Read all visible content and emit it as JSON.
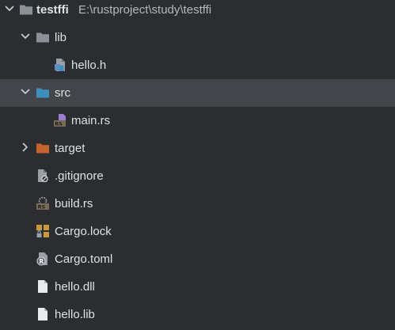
{
  "project_tree": {
    "root": {
      "name": "testffi",
      "path": "E:\\rustproject\\study\\testffi",
      "icon": "folder-icon",
      "expanded": true
    },
    "items": [
      {
        "label": "lib",
        "icon": "folder-icon",
        "type": "folder",
        "expanded": true
      },
      {
        "label": "hello.h",
        "icon": "c-header-file-icon",
        "type": "file"
      },
      {
        "label": "src",
        "icon": "source-folder-icon",
        "type": "folder",
        "expanded": true,
        "selected": true
      },
      {
        "label": "main.rs",
        "icon": "rust-main-file-icon",
        "type": "file"
      },
      {
        "label": "target",
        "icon": "excluded-folder-icon",
        "type": "folder",
        "expanded": false
      },
      {
        "label": ".gitignore",
        "icon": "ignore-file-icon",
        "type": "file"
      },
      {
        "label": "build.rs",
        "icon": "rust-file-icon",
        "type": "file"
      },
      {
        "label": "Cargo.lock",
        "icon": "lock-file-icon",
        "type": "file"
      },
      {
        "label": "Cargo.toml",
        "icon": "cargo-toml-icon",
        "type": "file"
      },
      {
        "label": "hello.dll",
        "icon": "file-icon",
        "type": "file"
      },
      {
        "label": "hello.lib",
        "icon": "file-icon",
        "type": "file"
      }
    ]
  },
  "colors": {
    "background": "#2b2d30",
    "selected_row": "#43454a",
    "text": "#dfe1e5",
    "path_text": "#b4b8bf",
    "folder_gray": "#8c9199",
    "source_folder_blue": "#3d8dbd",
    "excluded_folder_orange": "#c6642e",
    "rust_badge": "#7a6a58",
    "cargo_lock_gold": "#c99a3a"
  }
}
